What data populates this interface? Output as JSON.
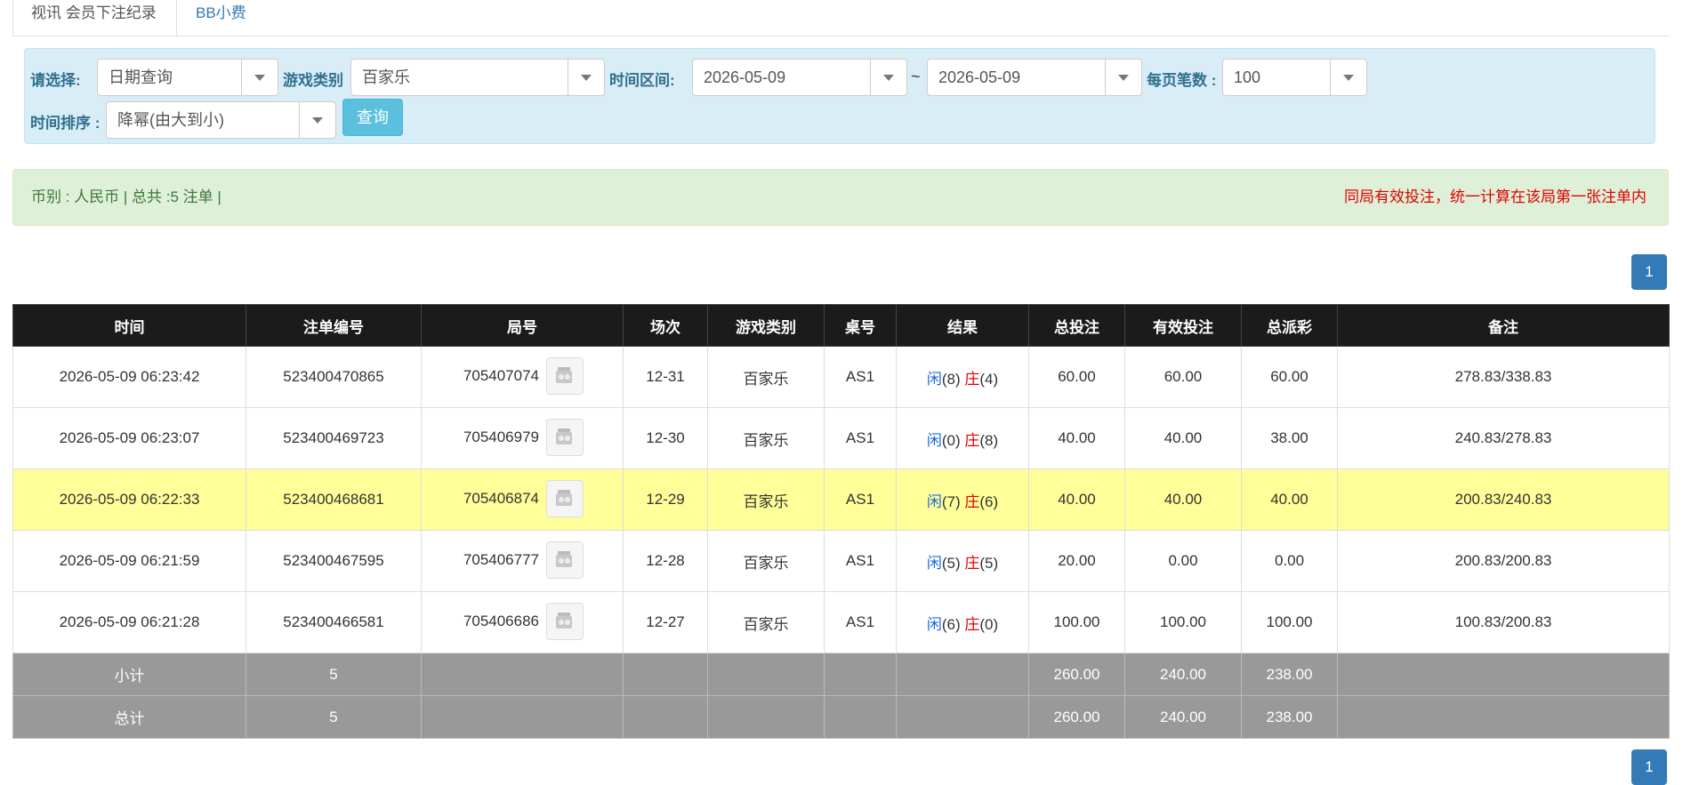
{
  "tabs": {
    "active_label": "视讯 会员下注纪录",
    "other_label": "BB小费"
  },
  "filter": {
    "choose_label": "请选择:",
    "choose_value": "日期查询",
    "game_type_label": "游戏类别",
    "game_type_value": "百家乐",
    "time_range_label": "时间区间:",
    "date_from": "2026-05-09",
    "tilde": "~",
    "date_to": "2026-05-09",
    "per_page_label": "每页笔数 :",
    "per_page_value": "100",
    "sort_label": "时间排序 :",
    "sort_value": "降幂(由大到小)",
    "query_button": "查询"
  },
  "summary": {
    "left": "币别 : 人民币 | 总共 :5 注单 |",
    "right": "同局有效投注，统一计算在该局第一张注单内"
  },
  "pagination": {
    "page": "1"
  },
  "table": {
    "headers": [
      "时间",
      "注单编号",
      "局号",
      "场次",
      "游戏类别",
      "桌号",
      "结果",
      "总投注",
      "有效投注",
      "总派彩",
      "备注"
    ],
    "result_player": "闲",
    "result_banker": "庄",
    "rows": [
      {
        "time": "2026-05-09 06:23:42",
        "bet_no": "523400470865",
        "round_no": "705407074",
        "session": "12-31",
        "game": "百家乐",
        "table": "AS1",
        "player": "(8)",
        "banker": "(4)",
        "total_bet": "60.00",
        "valid_bet": "60.00",
        "payout": "60.00",
        "note": "278.83/338.83"
      },
      {
        "time": "2026-05-09 06:23:07",
        "bet_no": "523400469723",
        "round_no": "705406979",
        "session": "12-30",
        "game": "百家乐",
        "table": "AS1",
        "player": "(0)",
        "banker": "(8)",
        "total_bet": "40.00",
        "valid_bet": "40.00",
        "payout": "38.00",
        "note": "240.83/278.83"
      },
      {
        "time": "2026-05-09 06:22:33",
        "bet_no": "523400468681",
        "round_no": "705406874",
        "session": "12-29",
        "game": "百家乐",
        "table": "AS1",
        "player": "(7)",
        "banker": "(6)",
        "total_bet": "40.00",
        "valid_bet": "40.00",
        "payout": "40.00",
        "note": "200.83/240.83"
      },
      {
        "time": "2026-05-09 06:21:59",
        "bet_no": "523400467595",
        "round_no": "705406777",
        "session": "12-28",
        "game": "百家乐",
        "table": "AS1",
        "player": "(5)",
        "banker": "(5)",
        "total_bet": "20.00",
        "valid_bet": "0.00",
        "payout": "0.00",
        "note": "200.83/200.83"
      },
      {
        "time": "2026-05-09 06:21:28",
        "bet_no": "523400466581",
        "round_no": "705406686",
        "session": "12-27",
        "game": "百家乐",
        "table": "AS1",
        "player": "(6)",
        "banker": "(0)",
        "total_bet": "100.00",
        "valid_bet": "100.00",
        "payout": "100.00",
        "note": "100.83/200.83"
      }
    ],
    "subtotal": {
      "label": "小计",
      "count": "5",
      "total_bet": "260.00",
      "valid_bet": "240.00",
      "payout": "238.00"
    },
    "grand_total": {
      "label": "总计",
      "count": "5",
      "total_bet": "260.00",
      "valid_bet": "240.00",
      "payout": "238.00"
    }
  },
  "colors": {
    "header_bg": "#1b1b1b",
    "highlight_row": "#ffff99",
    "total_row_bg": "#999999",
    "link_blue": "#337ab7",
    "banker_red": "#e00000",
    "filter_bg": "#d9edf7",
    "summary_bg": "#dff0d8"
  },
  "icons": {
    "round_replay": "film-reel-icon",
    "dropdown": "caret-down-icon"
  }
}
